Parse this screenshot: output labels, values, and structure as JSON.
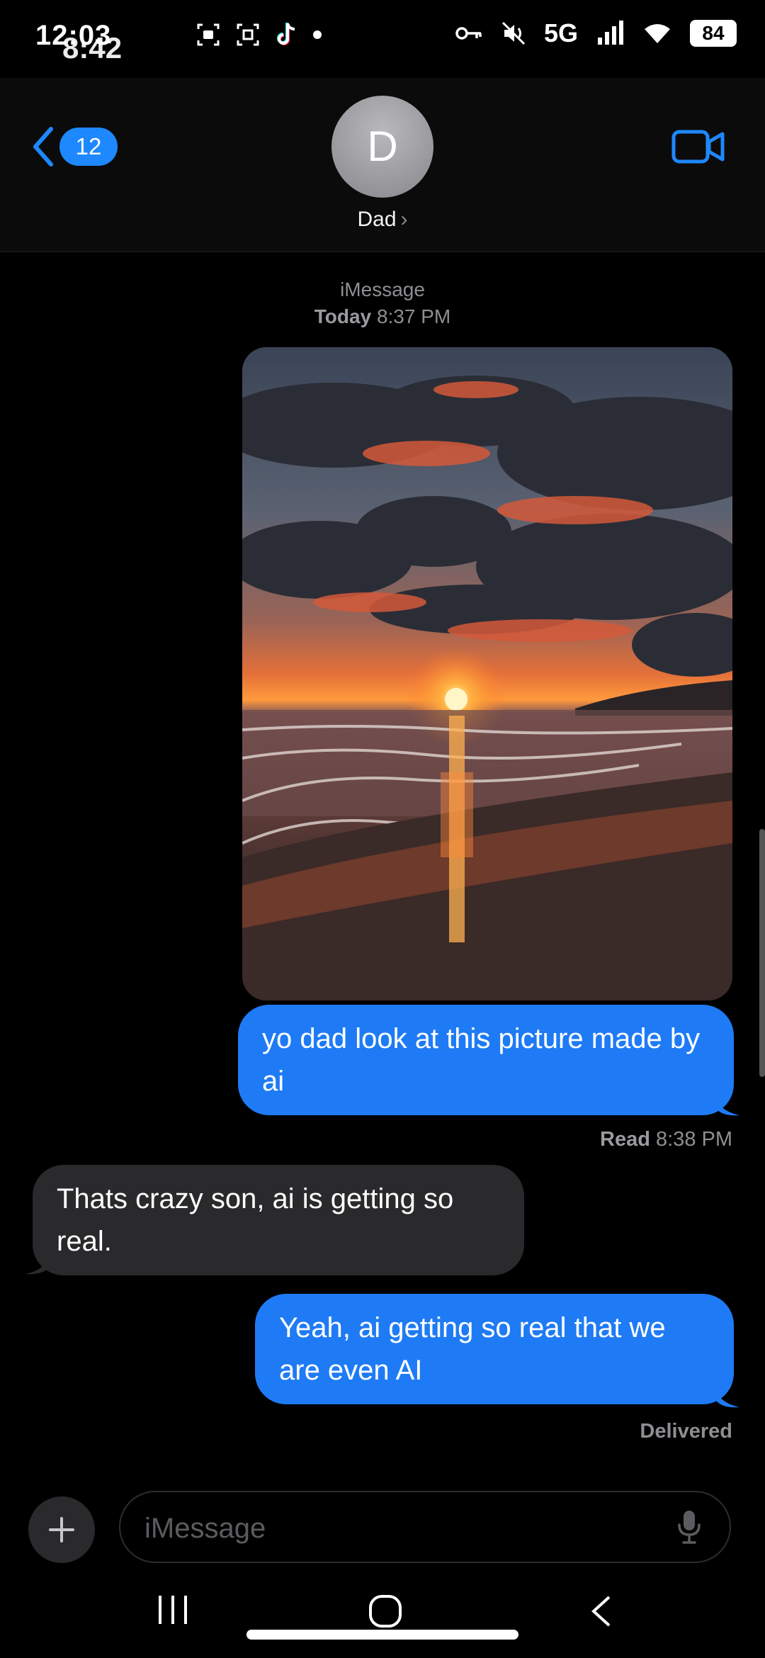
{
  "status_bar": {
    "time": "12:03",
    "time_overlay": "8:42",
    "network": "5G",
    "battery": "84"
  },
  "header": {
    "unread_count": "12",
    "avatar_initial": "D",
    "contact_name": "Dad",
    "contact_chevron": "›"
  },
  "conversation": {
    "service": "iMessage",
    "day": "Today",
    "time": "8:37 PM",
    "messages": [
      {
        "from": "me",
        "type": "image"
      },
      {
        "from": "me",
        "text": "yo dad look at this picture made by ai"
      },
      {
        "from": "them",
        "text": "Thats crazy son, ai is getting so real."
      },
      {
        "from": "me",
        "text": "Yeah, ai getting so real that we are even AI"
      }
    ],
    "read_label": "Read",
    "read_time": "8:38 PM",
    "delivered": "Delivered"
  },
  "composer": {
    "placeholder": "iMessage"
  },
  "icons": {
    "back": "chevron-left-icon",
    "video": "video-camera-icon",
    "plus": "plus-icon",
    "mic": "microphone-icon"
  },
  "colors": {
    "accent": "#1e7bf5",
    "incoming": "#2a2a2c",
    "background": "#000000"
  }
}
